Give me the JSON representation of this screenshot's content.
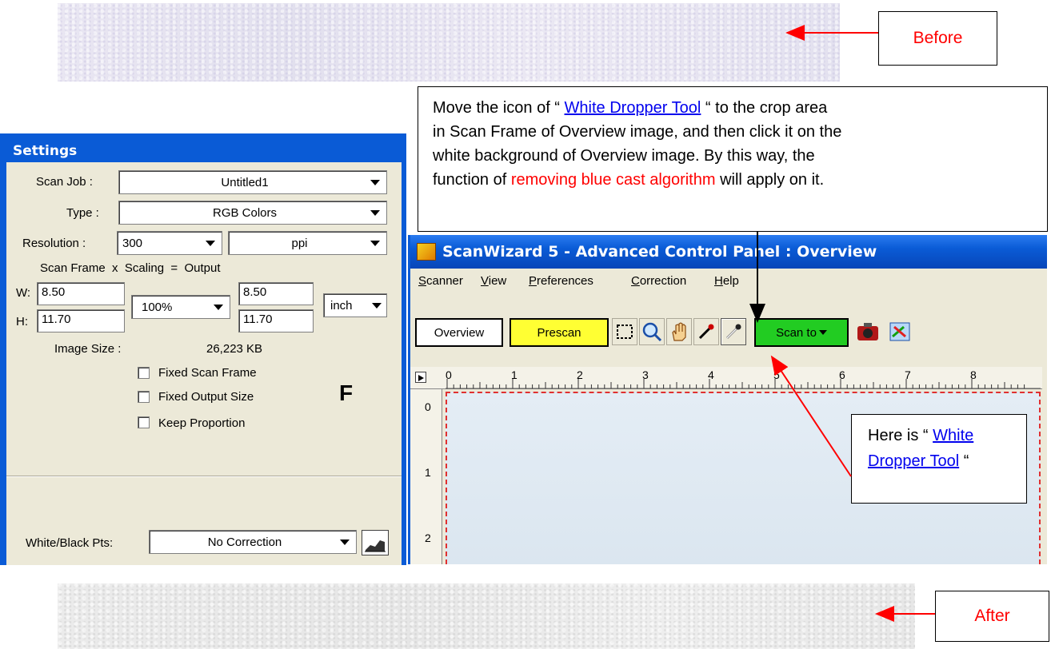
{
  "labels": {
    "before": "Before",
    "after": "After"
  },
  "callout_main": {
    "line1_a": "Move the icon of “ ",
    "line1_link": "White Dropper Tool",
    "line1_b": " “ to the crop area",
    "line2": "in Scan Frame of Overview image, and then click it on the",
    "line3": "white background of Overview image. By this way, the",
    "line4_a": "function of ",
    "line4_red": "removing blue cast algorithm",
    "line4_b": " will apply on it."
  },
  "callout_tool": {
    "prefix": "Here is “ ",
    "link_1": "White",
    "link_2": "Dropper Tool",
    "suffix": " “"
  },
  "settings": {
    "title": "Settings",
    "scan_job_label": "Scan Job :",
    "scan_job_value": "Untitled1",
    "type_label": "Type :",
    "type_value": "RGB Colors",
    "resolution_label": "Resolution :",
    "resolution_value": "300",
    "resolution_unit": "ppi",
    "formula_header": "Scan Frame  x  Scaling  =  Output",
    "w_label": "W:",
    "w_value": "8.50",
    "h_label": "H:",
    "h_value": "11.70",
    "scaling_value": "100%",
    "out_w_value": "8.50",
    "out_h_value": "11.70",
    "unit_value": "inch",
    "image_size_label": "Image Size :",
    "image_size_value": "26,223 KB",
    "fixed_scan_frame": "Fixed Scan Frame",
    "fixed_output_size": "Fixed Output Size",
    "keep_proportion": "Keep Proportion",
    "f_badge": "F",
    "wb_label": "White/Black Pts:",
    "wb_value": "No Correction"
  },
  "scanwizard": {
    "title": "ScanWizard 5 - Advanced Control Panel : Overview",
    "menu": [
      {
        "first": "S",
        "rest": "canner"
      },
      {
        "first": "V",
        "rest": "iew"
      },
      {
        "first": "P",
        "rest": "references"
      },
      {
        "first": "C",
        "rest": "orrection"
      },
      {
        "first": "H",
        "rest": "elp"
      }
    ],
    "overview_button": "Overview",
    "prescan_button": "Prescan",
    "scan_to_button": "Scan to",
    "ruler_numbers": [
      "0",
      "1",
      "2",
      "3",
      "4",
      "5",
      "6",
      "7",
      "8"
    ],
    "vruler_numbers": [
      "0",
      "1",
      "2"
    ]
  },
  "colors": {
    "red": "#ff0000",
    "titlebar": "#0a5bd6",
    "prescan": "#ffff33",
    "scan_to": "#22cc22"
  }
}
